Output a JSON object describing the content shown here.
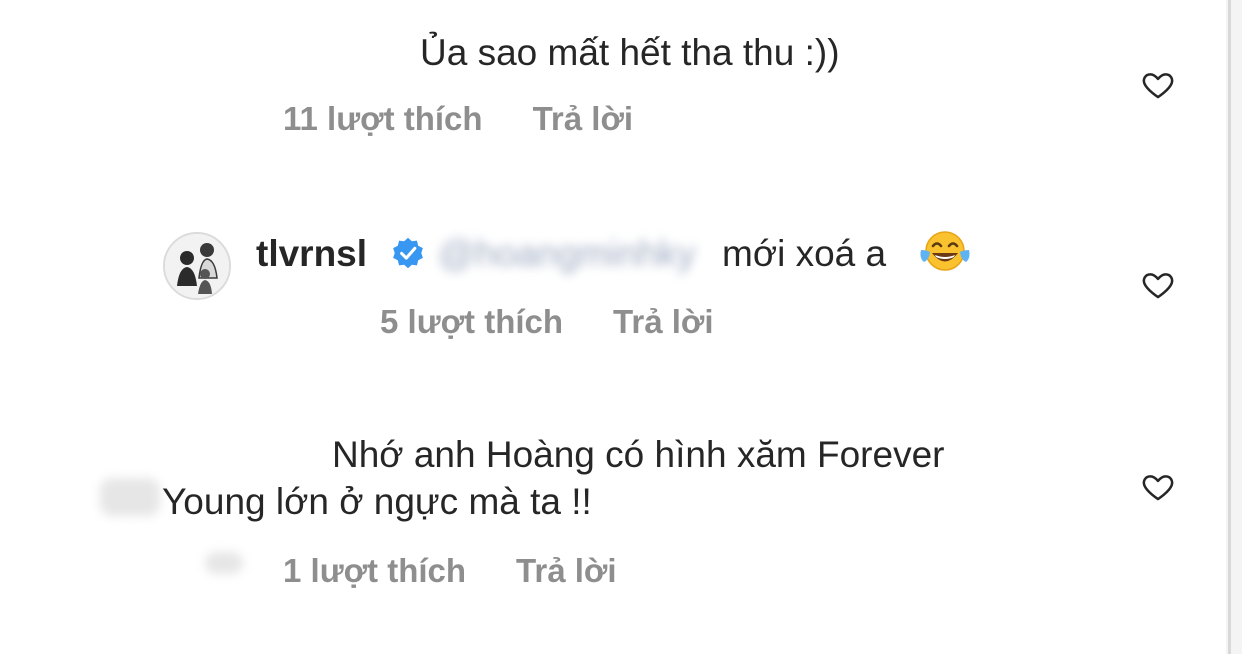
{
  "comments": [
    {
      "text": "Ủa sao mất hết tha thu :))",
      "likes": "11 lượt thích",
      "reply": "Trả lời"
    },
    {
      "username": "tlvrnsl",
      "mention": "@hoangminhky",
      "text": "mới xoá a",
      "emoji": "face-with-tears-of-joy",
      "likes": "5 lượt thích",
      "reply": "Trả lời"
    },
    {
      "text_line1": "Nhớ anh Hoàng có hình xăm Forever",
      "text_line2": "Young lớn ở ngực mà ta !!",
      "likes": "1 lượt thích",
      "reply": "Trả lời"
    }
  ],
  "colors": {
    "text": "#262626",
    "meta": "#8e8e8e",
    "verified": "#3897f0",
    "background": "#ffffff"
  },
  "icons": [
    "heart-outline-icon",
    "verified-badge-icon"
  ]
}
